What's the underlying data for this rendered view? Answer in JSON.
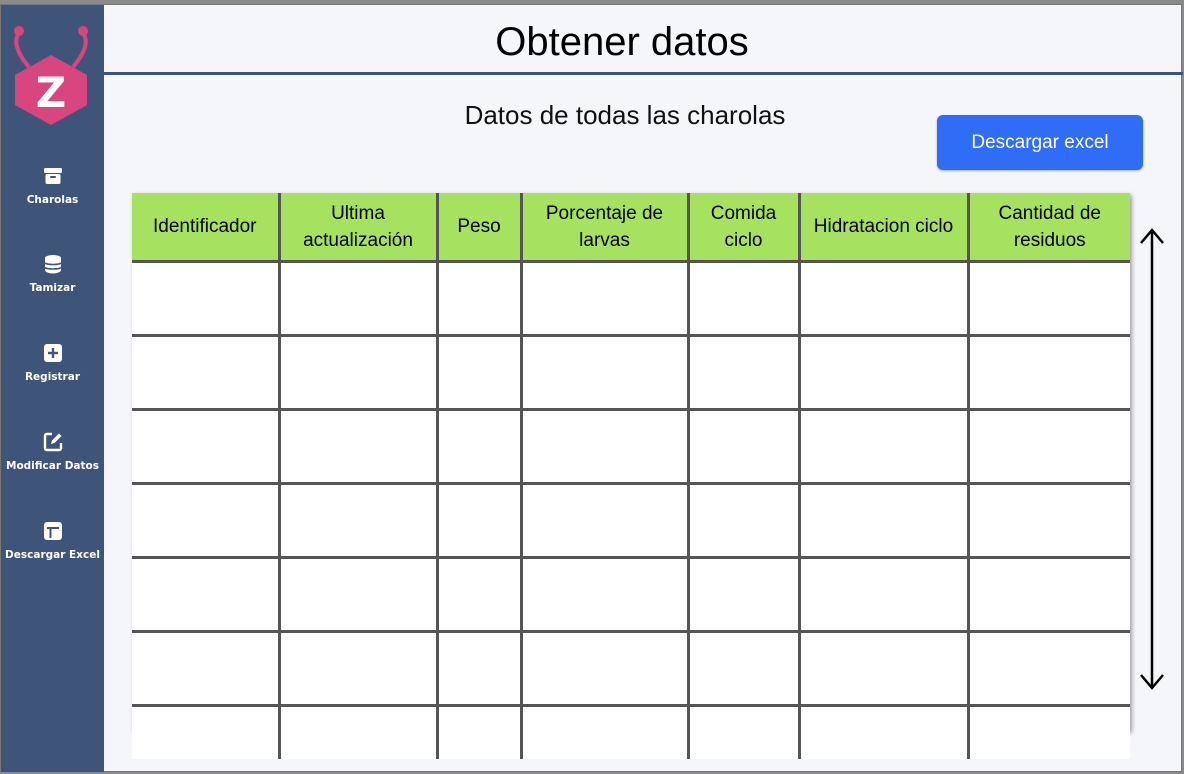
{
  "sidebar": {
    "logo_letter": "Z",
    "items": [
      {
        "label": "Charolas",
        "icon": "archive-box-icon"
      },
      {
        "label": "Tamizar",
        "icon": "database-icon"
      },
      {
        "label": "Registrar",
        "icon": "plus-square-icon"
      },
      {
        "label": "Modificar Datos",
        "icon": "edit-icon"
      },
      {
        "label": "Descargar Excel",
        "icon": "table-icon"
      }
    ]
  },
  "header": {
    "title": "Obtener datos",
    "subtitle": "Datos de todas las charolas"
  },
  "actions": {
    "download_label": "Descargar excel"
  },
  "table": {
    "columns": [
      "Identificador",
      "Ultima actualización",
      "Peso",
      "Porcentaje de larvas",
      "Comida ciclo",
      "Hidratacion ciclo",
      "Cantidad de residuos"
    ],
    "rows": [
      [
        "",
        "",
        "",
        "",
        "",
        "",
        ""
      ],
      [
        "",
        "",
        "",
        "",
        "",
        "",
        ""
      ],
      [
        "",
        "",
        "",
        "",
        "",
        "",
        ""
      ],
      [
        "",
        "",
        "",
        "",
        "",
        "",
        ""
      ],
      [
        "",
        "",
        "",
        "",
        "",
        "",
        ""
      ],
      [
        "",
        "",
        "",
        "",
        "",
        "",
        ""
      ],
      [
        "",
        "",
        "",
        "",
        "",
        "",
        ""
      ]
    ]
  },
  "colors": {
    "sidebar": "#3f5479",
    "header_row": "#a6e25f",
    "button": "#2f6df6",
    "logo": "#d9457f"
  }
}
